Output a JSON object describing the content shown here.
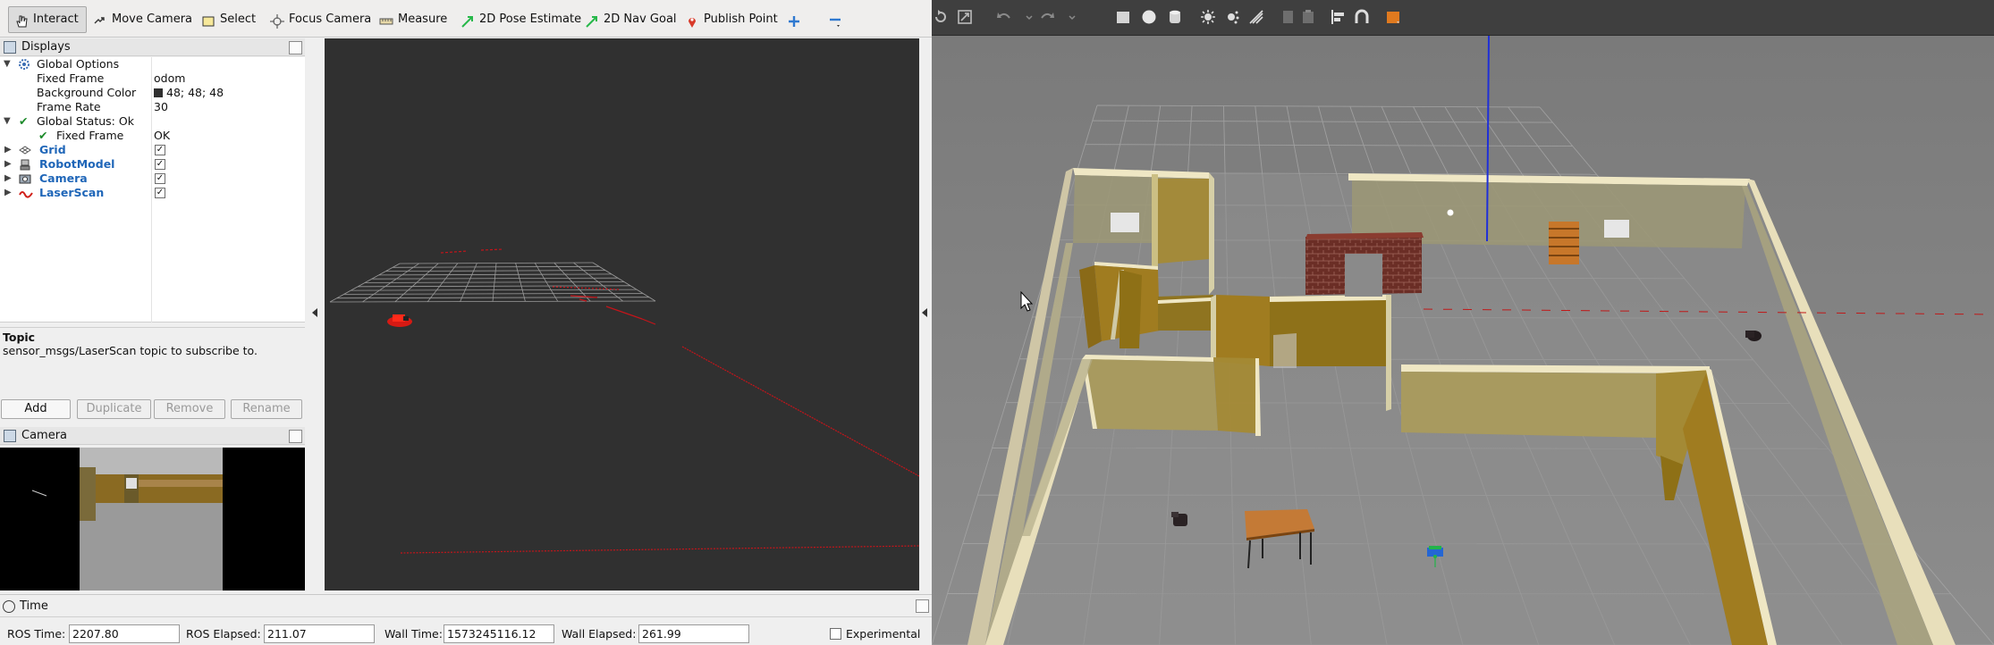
{
  "rviz": {
    "toolbar": {
      "interact": "Interact",
      "move_camera": "Move Camera",
      "select": "Select",
      "focus_camera": "Focus Camera",
      "measure": "Measure",
      "pose_estimate": "2D Pose Estimate",
      "nav_goal": "2D Nav Goal",
      "publish_point": "Publish Point"
    },
    "displays": {
      "title": "Displays",
      "global_options": "Global Options",
      "fixed_frame_label": "Fixed Frame",
      "fixed_frame_value": "odom",
      "background_color_label": "Background Color",
      "background_color_value": "48; 48; 48",
      "frame_rate_label": "Frame Rate",
      "frame_rate_value": "30",
      "global_status": "Global Status: Ok",
      "status_fixed_frame_label": "Fixed Frame",
      "status_fixed_frame_value": "OK",
      "items": [
        {
          "label": "Grid",
          "checked": true
        },
        {
          "label": "RobotModel",
          "checked": true
        },
        {
          "label": "Camera",
          "checked": true
        },
        {
          "label": "LaserScan",
          "checked": true
        }
      ]
    },
    "topic": {
      "title": "Topic",
      "description": "sensor_msgs/LaserScan topic to subscribe to."
    },
    "buttons": {
      "add": "Add",
      "duplicate": "Duplicate",
      "remove": "Remove",
      "rename": "Rename"
    },
    "camera_panel": {
      "title": "Camera"
    },
    "time": {
      "title": "Time",
      "ros_time_label": "ROS Time:",
      "ros_time": "2207.80",
      "ros_elapsed_label": "ROS Elapsed:",
      "ros_elapsed": "211.07",
      "wall_time_label": "Wall Time:",
      "wall_time": "1573245116.12",
      "wall_elapsed_label": "Wall Elapsed:",
      "wall_elapsed": "261.99",
      "experimental": "Experimental"
    },
    "colors": {
      "background": "#303030",
      "laser": "#d01010",
      "link": "#1f66b8"
    }
  },
  "gazebo": {
    "colors": {
      "toolbar": "#3f3f3f",
      "floor": "#8a8a8a",
      "wall": "#c2b796",
      "wood": "#a37c25",
      "brick": "#6b2e26",
      "accent": "#e07a1f"
    }
  }
}
